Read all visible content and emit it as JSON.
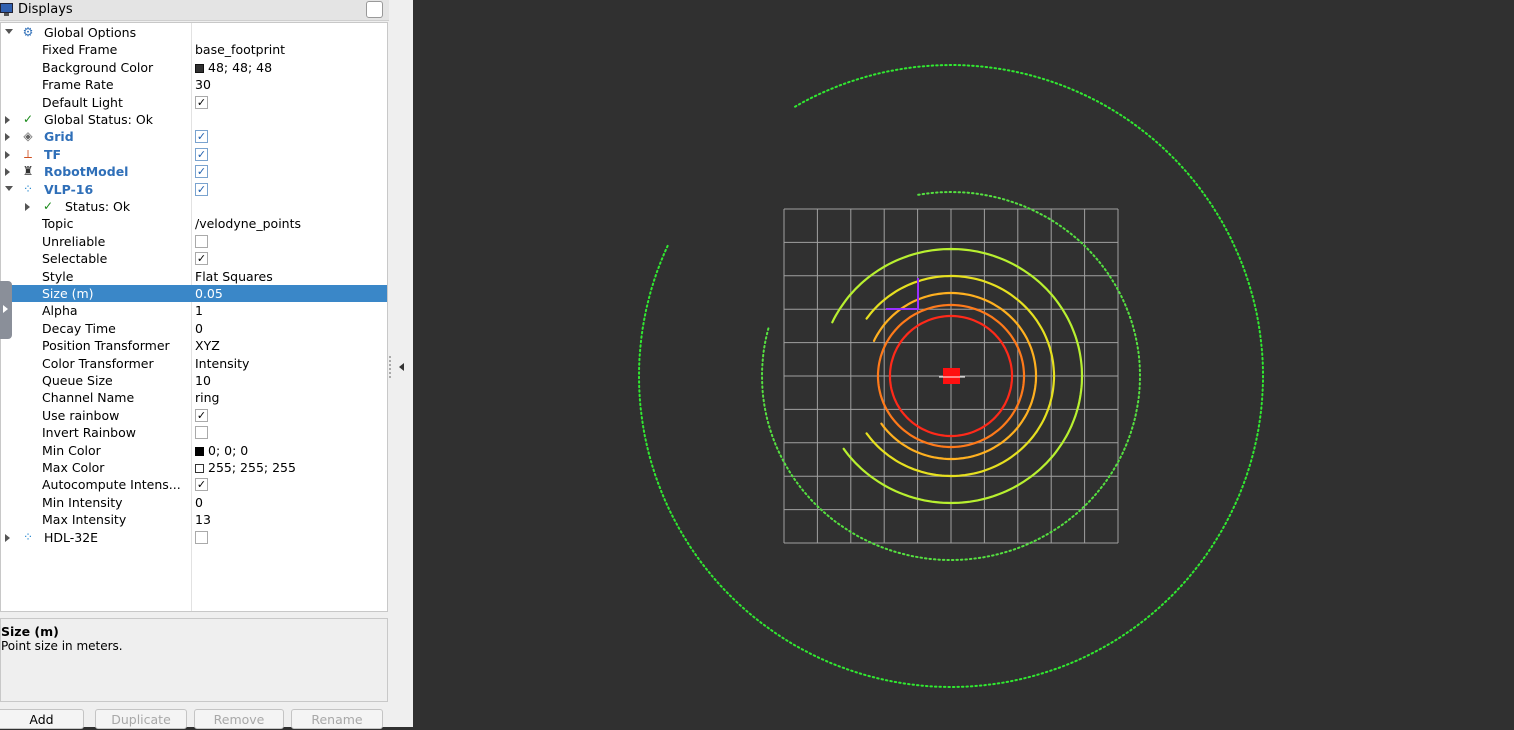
{
  "panel": {
    "title": "Displays",
    "rows": [
      {
        "label": "Global Options",
        "indent": 0,
        "expander": "open",
        "icon": "gear-icon"
      },
      {
        "label": "Fixed Frame",
        "indent": 1,
        "value": "base_footprint"
      },
      {
        "label": "Background Color",
        "indent": 1,
        "value": "48; 48; 48",
        "swatch": "#303030"
      },
      {
        "label": "Frame Rate",
        "indent": 1,
        "value": "30"
      },
      {
        "label": "Default Light",
        "indent": 1,
        "checkbox": true,
        "checked": true
      },
      {
        "label": "Global Status: Ok",
        "indent": 0,
        "expander": "closed",
        "icon": "check-icon"
      },
      {
        "label": "Grid",
        "indent": 0,
        "expander": "closed",
        "icon": "grid-icon",
        "bold": true,
        "checkbox": true,
        "checked": true,
        "blue": true
      },
      {
        "label": "TF",
        "indent": 0,
        "expander": "closed",
        "icon": "tf-axes-icon",
        "bold": true,
        "checkbox": true,
        "checked": true,
        "blue": true
      },
      {
        "label": "RobotModel",
        "indent": 0,
        "expander": "closed",
        "icon": "robot-icon",
        "bold": true,
        "checkbox": true,
        "checked": true,
        "blue": true
      },
      {
        "label": "VLP-16",
        "indent": 0,
        "expander": "open",
        "icon": "pointcloud-icon",
        "bold": true,
        "checkbox": true,
        "checked": true,
        "blue": true
      },
      {
        "label": "Status: Ok",
        "indent": 1,
        "expander": "closed",
        "icon": "check-icon"
      },
      {
        "label": "Topic",
        "indent": 1,
        "value": "/velodyne_points"
      },
      {
        "label": "Unreliable",
        "indent": 1,
        "checkbox": true,
        "checked": false
      },
      {
        "label": "Selectable",
        "indent": 1,
        "checkbox": true,
        "checked": true
      },
      {
        "label": "Style",
        "indent": 1,
        "value": "Flat Squares"
      },
      {
        "label": "Size (m)",
        "indent": 1,
        "value": "0.05",
        "selected": true
      },
      {
        "label": "Alpha",
        "indent": 1,
        "value": "1"
      },
      {
        "label": "Decay Time",
        "indent": 1,
        "value": "0"
      },
      {
        "label": "Position Transformer",
        "indent": 1,
        "value": "XYZ"
      },
      {
        "label": "Color Transformer",
        "indent": 1,
        "value": "Intensity"
      },
      {
        "label": "Queue Size",
        "indent": 1,
        "value": "10"
      },
      {
        "label": "Channel Name",
        "indent": 1,
        "value": "ring"
      },
      {
        "label": "Use rainbow",
        "indent": 1,
        "checkbox": true,
        "checked": true
      },
      {
        "label": "Invert Rainbow",
        "indent": 1,
        "checkbox": true,
        "checked": false
      },
      {
        "label": "Min Color",
        "indent": 1,
        "value": "0; 0; 0",
        "swatch": "#000000"
      },
      {
        "label": "Max Color",
        "indent": 1,
        "value": "255; 255; 255",
        "swatch": "#ffffff"
      },
      {
        "label": "Autocompute Intens...",
        "indent": 1,
        "checkbox": true,
        "checked": true
      },
      {
        "label": "Min Intensity",
        "indent": 1,
        "value": "0"
      },
      {
        "label": "Max Intensity",
        "indent": 1,
        "value": "13"
      },
      {
        "label": "HDL-32E",
        "indent": 0,
        "expander": "closed",
        "icon": "pointcloud-icon",
        "checkbox": true,
        "checked": false
      }
    ],
    "description": {
      "title": "Size (m)",
      "text": "Point size in meters."
    },
    "buttons": {
      "add": "Add",
      "duplicate": "Duplicate",
      "remove": "Remove",
      "rename": "Rename"
    }
  },
  "viewport": {
    "background_color": "#303030"
  }
}
